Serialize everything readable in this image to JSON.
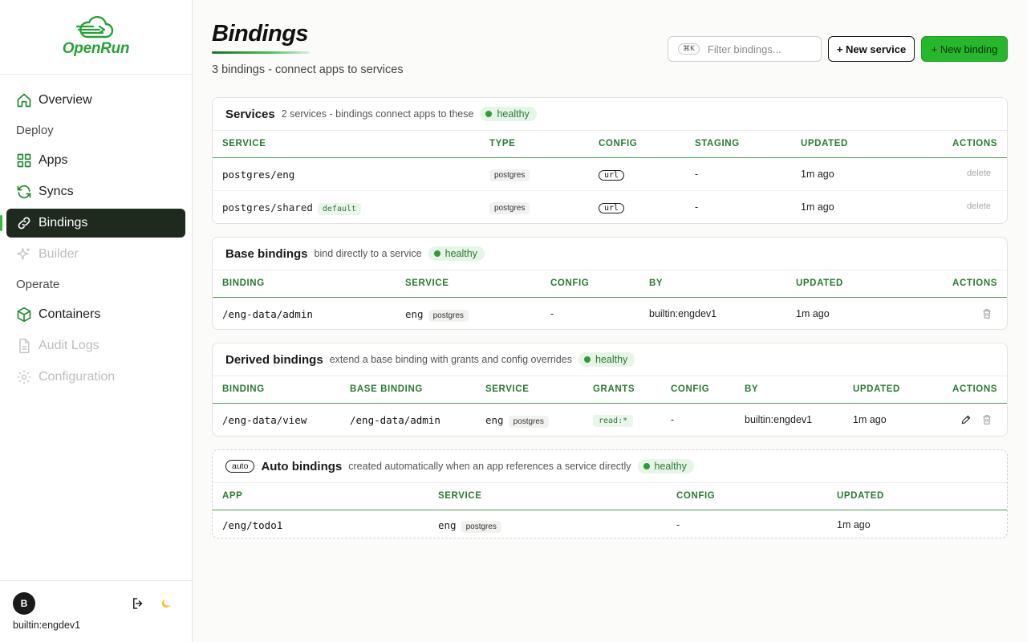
{
  "brand": {
    "name": "OpenRun"
  },
  "sidebar": {
    "items": [
      {
        "label": "Overview",
        "icon": "home-icon"
      },
      {
        "section": "Deploy"
      },
      {
        "label": "Apps",
        "icon": "grid-icon"
      },
      {
        "label": "Syncs",
        "icon": "refresh-icon"
      },
      {
        "label": "Bindings",
        "icon": "link-icon",
        "active": true
      },
      {
        "label": "Builder",
        "icon": "sparkle-icon",
        "disabled": true
      },
      {
        "section": "Operate"
      },
      {
        "label": "Containers",
        "icon": "cube-icon"
      },
      {
        "label": "Audit Logs",
        "icon": "file-icon",
        "disabled": true
      },
      {
        "label": "Configuration",
        "icon": "gear-icon",
        "disabled": true
      }
    ],
    "user": {
      "initial": "B",
      "name": "builtin:engdev1"
    }
  },
  "header": {
    "title": "Bindings",
    "subtitle": "3 bindings - connect apps to services",
    "search_shortcut": "⌘K",
    "search_placeholder": "Filter bindings...",
    "new_service": "+ New service",
    "new_binding": "+ New binding"
  },
  "services": {
    "title": "Services",
    "desc": "2 services - bindings connect apps to these",
    "status": "healthy",
    "columns": [
      "SERVICE",
      "TYPE",
      "CONFIG",
      "STAGING",
      "UPDATED",
      "ACTIONS"
    ],
    "rows": [
      {
        "service": "postgres/eng",
        "tag": "",
        "type": "postgres",
        "config": "url",
        "staging": "-",
        "updated": "1m ago",
        "action": "delete"
      },
      {
        "service": "postgres/shared",
        "tag": "default",
        "type": "postgres",
        "config": "url",
        "staging": "-",
        "updated": "1m ago",
        "action": "delete"
      }
    ]
  },
  "base": {
    "title": "Base bindings",
    "desc": "bind directly to a service",
    "status": "healthy",
    "columns": [
      "BINDING",
      "SERVICE",
      "CONFIG",
      "BY",
      "UPDATED",
      "ACTIONS"
    ],
    "rows": [
      {
        "binding": "/eng-data/admin",
        "service": "eng",
        "type": "postgres",
        "config": "-",
        "by": "builtin:engdev1",
        "updated": "1m ago"
      }
    ]
  },
  "derived": {
    "title": "Derived bindings",
    "desc": "extend a base binding with grants and config overrides",
    "status": "healthy",
    "columns": [
      "BINDING",
      "BASE BINDING",
      "SERVICE",
      "GRANTS",
      "CONFIG",
      "BY",
      "UPDATED",
      "ACTIONS"
    ],
    "rows": [
      {
        "binding": "/eng-data/view",
        "base": "/eng-data/admin",
        "service": "eng",
        "type": "postgres",
        "grants": "read:*",
        "config": "-",
        "by": "builtin:engdev1",
        "updated": "1m ago"
      }
    ]
  },
  "auto": {
    "tag": "auto",
    "title": "Auto bindings",
    "desc": "created automatically when an app references a service directly",
    "status": "healthy",
    "columns": [
      "APP",
      "SERVICE",
      "CONFIG",
      "UPDATED"
    ],
    "rows": [
      {
        "app": "/eng/todo1",
        "service": "eng",
        "type": "postgres",
        "config": "-",
        "updated": "1m ago"
      }
    ]
  },
  "colors": {
    "accent": "#25b82a",
    "active_nav": "#1f2a1f",
    "header_green": "#2a7a31"
  }
}
